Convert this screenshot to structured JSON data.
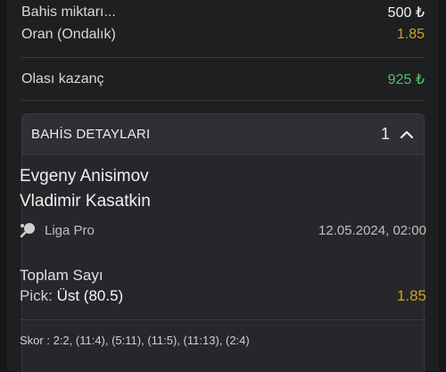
{
  "summary": {
    "stake_label": "Bahis miktarı...",
    "stake_value": "500 ₺",
    "odds_label": "Oran (Ondalık)",
    "odds_value": "1.85",
    "payout_label": "Olası kazanç",
    "payout_value": "925 ₺"
  },
  "details": {
    "header_title": "BAHİS DETAYLARI",
    "count": "1",
    "team_home": "Evgeny Anisimov",
    "team_away": "Vladimir Kasatkin",
    "league": "Liga Pro",
    "datetime": "12.05.2024, 02:00",
    "market": "Toplam Sayı",
    "pick_key": "Pick:",
    "pick_value": "Üst (80.5)",
    "pick_odds": "1.85",
    "score_label": "Skor :",
    "score_value": "2:2, (11:4), (5:11), (11:5), (11:13), (2:4)"
  },
  "icons": {
    "sport": "table-tennis-icon",
    "collapse": "chevron-up-icon"
  },
  "colors": {
    "odds": "#c9a227",
    "payout": "#4fbf67",
    "background": "#1e1f21"
  }
}
